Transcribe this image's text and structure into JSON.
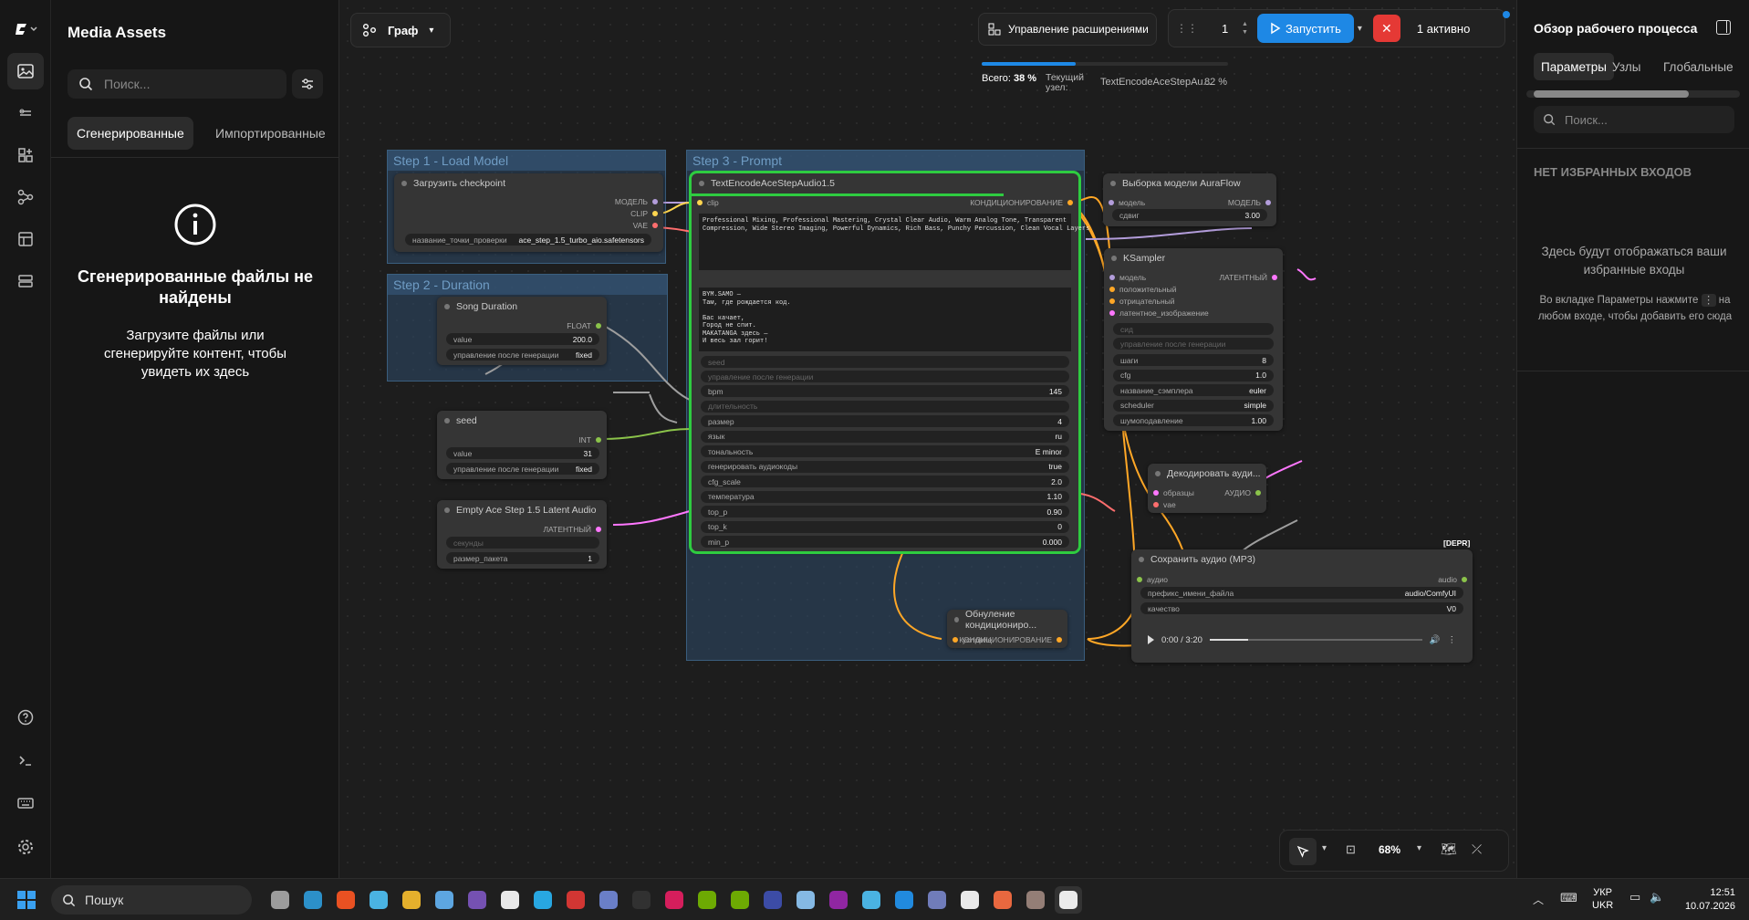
{
  "media": {
    "title": "Media Assets",
    "search_placeholder": "Поиск...",
    "tab_generated": "Сгенерированные",
    "tab_imported": "Импортированные",
    "empty_title": "Сгенерированные файлы не найдены",
    "empty_text": "Загрузите файлы или сгенерируйте контент, чтобы увидеть их здесь"
  },
  "toolbar": {
    "graph_label": "Граф",
    "extensions_label": "Управление расширениями",
    "batch_count": "1",
    "run_label": "Запустить",
    "active_label": "1 активно",
    "total_label": "Всего:",
    "total_pct": "38 %",
    "current_label": "Текущий узел:",
    "current_node": "TextEncodeAceStepAu...",
    "current_pct": "82 %",
    "total_progress": 0.38,
    "node_progress": 0.82
  },
  "groups": {
    "g1": "Step 1 - Load Model",
    "g2": "Step 2 - Duration",
    "g3": "Step 3 - Prompt"
  },
  "nodes": {
    "checkpoint": {
      "title": "Загрузить checkpoint",
      "out_model": "МОДЕЛЬ",
      "out_clip": "CLIP",
      "out_vae": "VAE",
      "w_label": "название_точки_проверки",
      "w_value": "ace_step_1.5_turbo_aio.safetensors"
    },
    "duration": {
      "title": "Song Duration",
      "out": "FLOAT",
      "value_label": "value",
      "value": "200.0",
      "ctrl_label": "управление после генерации",
      "ctrl_value": "fixed"
    },
    "seed": {
      "title": "seed",
      "out": "INT",
      "value_label": "value",
      "value": "31",
      "ctrl_label": "управление после генерации",
      "ctrl_value": "fixed"
    },
    "latent": {
      "title": "Empty Ace Step 1.5 Latent Audio",
      "out": "ЛАТЕНТНЫЙ",
      "in_seconds": "секунды",
      "w_label": "размер_пакета",
      "w_value": "1"
    },
    "encode": {
      "title": "TextEncodeAceStepAudio1.5",
      "in_clip": "clip",
      "out": "КОНДИЦИОНИРОВАНИЕ",
      "tags": "Professional Mixing, Professional Mastering, Crystal Clear Audio, Warm Analog Tone, Transparent\nCompression, Wide Stereo Imaging, Powerful Dynamics, Rich Bass, Punchy Percussion, Clean Vocal Layers",
      "lyrics": "BYM.SAMO —\nТам, где рождается код.\n\nБас качает,\nГород не спит.\nMAKATANGA здесь —\nИ весь зал горит!",
      "seed_label": "seed",
      "ctrl_label": "управление после генерации",
      "widgets": [
        {
          "label": "bpm",
          "value": "145"
        },
        {
          "label": "длительность",
          "value": ""
        },
        {
          "label": "размер",
          "value": "4"
        },
        {
          "label": "язык",
          "value": "ru"
        },
        {
          "label": "тональность",
          "value": "E minor"
        },
        {
          "label": "генерировать аудиокоды",
          "value": "true"
        },
        {
          "label": "cfg_scale",
          "value": "2.0"
        },
        {
          "label": "температура",
          "value": "1.10"
        },
        {
          "label": "top_p",
          "value": "0.90"
        },
        {
          "label": "top_k",
          "value": "0"
        },
        {
          "label": "min_p",
          "value": "0.000"
        }
      ]
    },
    "auraflow": {
      "title": "Выборка модели AuraFlow",
      "in": "модель",
      "out": "МОДЕЛЬ",
      "w_label": "сдвиг",
      "w_value": "3.00"
    },
    "ksampler": {
      "title": "KSampler",
      "out": "ЛАТЕНТНЫЙ",
      "inputs": [
        "модель",
        "положительный",
        "отрицательный",
        "латентное_изображение"
      ],
      "seed": "сид",
      "ctrl": "управление после генерации",
      "widgets": [
        {
          "label": "шаги",
          "value": "8"
        },
        {
          "label": "cfg",
          "value": "1.0"
        },
        {
          "label": "название_сэмплера",
          "value": "euler"
        },
        {
          "label": "scheduler",
          "value": "simple"
        },
        {
          "label": "шумоподавление",
          "value": "1.00"
        }
      ]
    },
    "decode": {
      "title": "Декодировать ауди...",
      "in_samples": "образцы",
      "in_vae": "vae",
      "out": "АУДИО"
    },
    "zero": {
      "title": "Обнуление кондиционирo...",
      "in": "условие",
      "out": "КОНДИЦИОНИРОВАНИЕ"
    },
    "save": {
      "title": "Сохранить аудио (MP3)",
      "badge": "[DEPR]",
      "in": "аудио",
      "out": "audio",
      "w1_label": "префикс_имени_файла",
      "w1_value": "audio/ComfyUI",
      "w2_label": "качество",
      "w2_value": "V0",
      "time": "0:00 / 3:20"
    }
  },
  "zoom": {
    "level": "68%"
  },
  "right": {
    "title": "Обзор рабочего процесса",
    "tabs": [
      "Параметры",
      "Узлы",
      "Глобальные"
    ],
    "search_placeholder": "Поиск...",
    "empty_title": "НЕТ ИЗБРАННЫХ ВХОДОВ",
    "empty_text": "Здесь будут отображаться ваши избранные входы",
    "hint_before": "Во вкладке Параметры нажмите",
    "hint_after": "на любом входе, чтобы добавить его сюда"
  },
  "taskbar": {
    "search": "Пошук",
    "lang1": "УКР",
    "lang2": "UKR",
    "time": "12:51",
    "date": "10.07.2026"
  },
  "colors": {
    "accent": "#1e88e5",
    "stop": "#e53935",
    "selected_node": "#2ecc40",
    "group_blue": "#2d4b69"
  }
}
